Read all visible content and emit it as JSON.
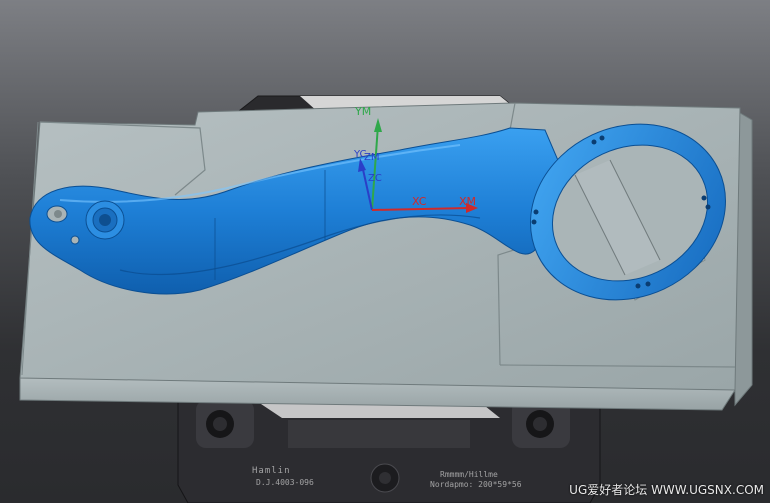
{
  "viewport": {
    "background_top": "#7d7f84",
    "background_bottom": "#2a2b2e",
    "part_color": "#1e7fd6",
    "mold_plate_color": "#a9b4b6",
    "base_color": "#2c2c30"
  },
  "csys": {
    "ym_label": "YM",
    "yc_label": "YC",
    "zm_label": "ZM",
    "zc_label": "ZC",
    "xc_label": "XC",
    "xm_label": "XM",
    "x_color": "#d02a2a",
    "y_color": "#2fa84a",
    "z_color": "#2a3fc8"
  },
  "base_plate": {
    "brand_text": "Hamlin",
    "code_text": "D.J.4003-096",
    "right_text_1": "Rmmmm/Hillme",
    "right_text_2": "Nordapmo: 200*59*56"
  },
  "watermark": {
    "text": "UG爱好者论坛 WWW.UGSNX.COM"
  }
}
